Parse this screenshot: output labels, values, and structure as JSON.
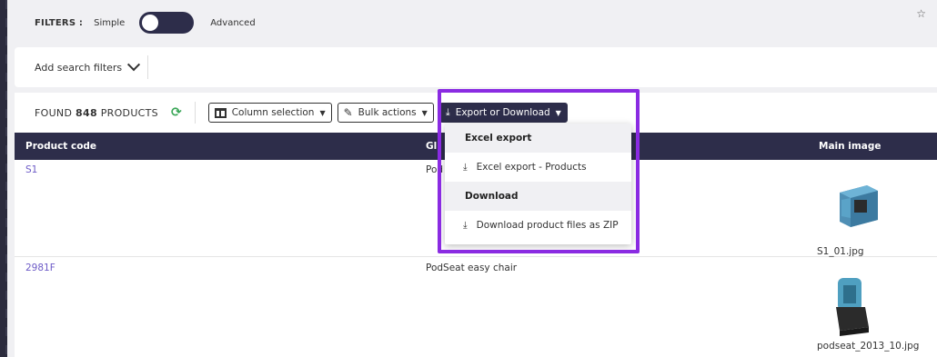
{
  "filters": {
    "label": "FILTERS :",
    "simple": "Simple",
    "advanced": "Advanced"
  },
  "search": {
    "add_filters": "Add search filters"
  },
  "toolbar": {
    "found_prefix": "FOUND",
    "found_count": "848",
    "found_suffix": "PRODUCTS",
    "column_selection": "Column selection",
    "bulk_actions": "Bulk actions",
    "export_download": "Export or Download"
  },
  "table": {
    "headers": [
      "Product code",
      "Gl",
      "Main image"
    ],
    "rows": [
      {
        "code": "S1",
        "name": "Pod",
        "image_file": "S1_01.jpg"
      },
      {
        "code": "2981F",
        "name": "PodSeat easy chair",
        "image_file": "podseat_2013_10.jpg"
      }
    ]
  },
  "dropdown": {
    "excel_header": "Excel export",
    "excel_item": "Excel export - Products",
    "download_header": "Download",
    "download_item": "Download product files as ZIP"
  },
  "colors": {
    "dark": "#2d2d4a",
    "accent": "#6d5bc7",
    "highlight": "#8a2be2",
    "refresh": "#3aa657"
  },
  "icons": [
    "refresh-icon",
    "columns-icon",
    "pencil-icon",
    "download-icon",
    "star-icon",
    "chevron-down-icon"
  ]
}
